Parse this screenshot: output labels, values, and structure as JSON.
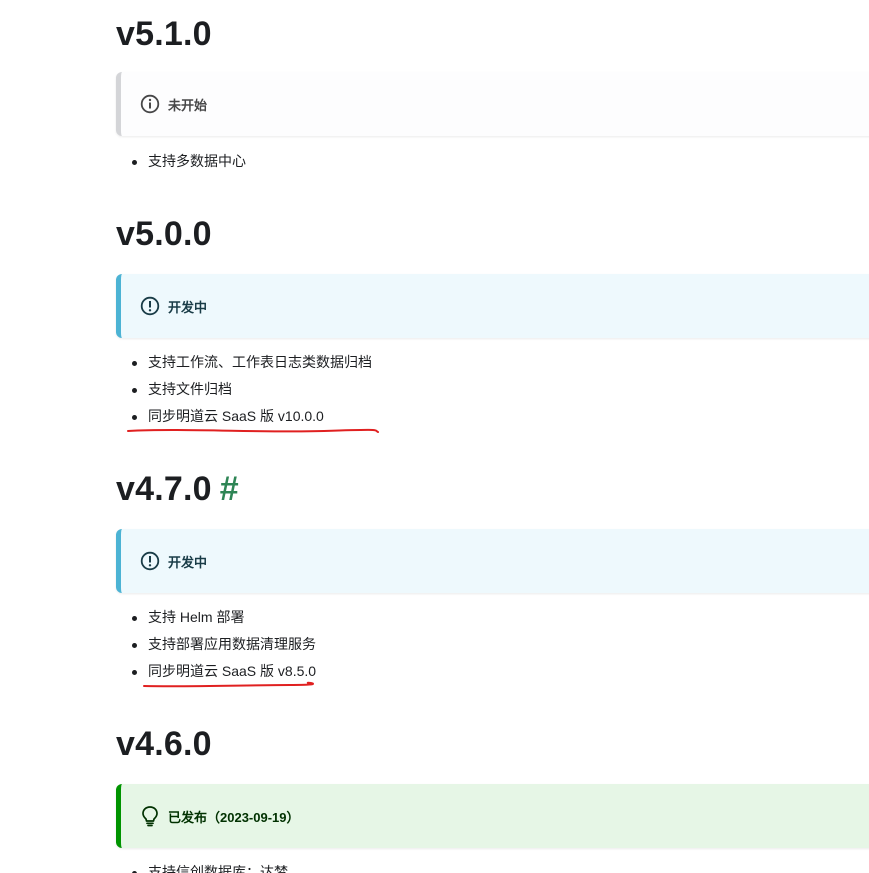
{
  "sections": [
    {
      "version": "v5.1.0",
      "status": "未开始",
      "status_icon": "info-circle-icon",
      "items": [
        "支持多数据中心"
      ]
    },
    {
      "version": "v5.0.0",
      "status": "开发中",
      "status_icon": "exclamation-circle-icon",
      "items": [
        "支持工作流、工作表日志类数据归档",
        "支持文件归档",
        "同步明道云 SaaS 版 v10.0.0"
      ]
    },
    {
      "version": "v4.7.0",
      "anchor": "#",
      "status": "开发中",
      "status_icon": "exclamation-circle-icon",
      "items": [
        "支持 Helm 部署",
        "支持部署应用数据清理服务",
        "同步明道云 SaaS 版 v8.5.0"
      ]
    },
    {
      "version": "v4.6.0",
      "status": "已发布（2023-09-19）",
      "status_icon": "lightbulb-icon",
      "items": [
        "支持信创数据库：达梦"
      ]
    }
  ],
  "colors": {
    "note_border": "#d4d5d8",
    "info_border": "#4cb3d4",
    "info_bg": "#eef9fd",
    "tip_border": "#009400",
    "tip_bg": "#e6f6e6",
    "anchor": "#2e8555",
    "annotation_red": "#e02020"
  }
}
